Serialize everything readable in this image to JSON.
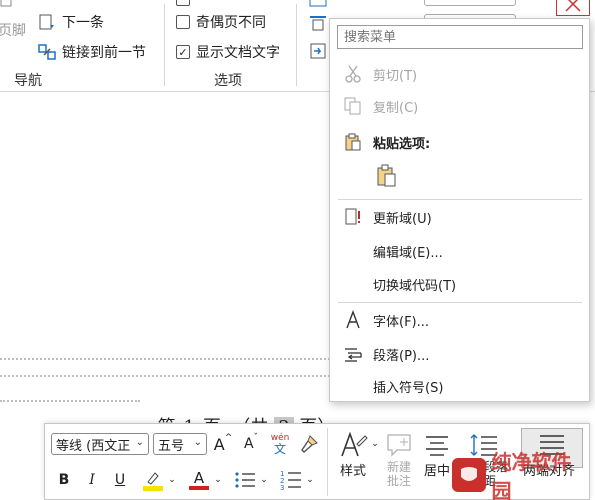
{
  "ribbon": {
    "header_footer_partial": "页脚",
    "next_item": "下一条",
    "link_to_previous": "链接到前一节",
    "nav_group": "导航",
    "odd_even_label": "奇偶页不同",
    "odd_even_checked": false,
    "show_doc_text_label": "显示文档文字",
    "show_doc_text_checked": true,
    "options_group": "选项",
    "checkmark": "✓"
  },
  "document": {
    "footer_parts": [
      "第",
      "1",
      "页",
      "（共",
      "3",
      "页）"
    ]
  },
  "menu": {
    "search_placeholder": "搜索菜单",
    "items": [
      {
        "label": "剪切(T)",
        "icon": "scissors-icon",
        "disabled": true
      },
      {
        "label": "复制(C)",
        "icon": "copy-icon",
        "disabled": true
      },
      {
        "label": "粘贴选项:",
        "icon": "paste-icon",
        "bold": true
      },
      {
        "label": "更新域(U)",
        "icon": "update-field-icon"
      },
      {
        "label": "编辑域(E)...",
        "icon": ""
      },
      {
        "label": "切换域代码(T)",
        "icon": ""
      },
      {
        "label": "字体(F)...",
        "icon": "font-icon"
      },
      {
        "label": "段落(P)...",
        "icon": "paragraph-icon"
      },
      {
        "label": "插入符号(S)",
        "icon": ""
      }
    ]
  },
  "mini_toolbar": {
    "font_name": "等线 (西文正",
    "font_size": "五号",
    "grow_font": "A",
    "shrink_font": "A",
    "phonetic_top": "wén",
    "phonetic_bottom": "文",
    "bold": "B",
    "italic": "I",
    "underline": "U",
    "font_color_letter": "A",
    "styles_label": "样式",
    "new_comment_label_1": "新建",
    "new_comment_label_2": "批注",
    "center_label": "居中",
    "line_spacing_label_1": "行和段落",
    "line_spacing_label_2": "间距",
    "justify_label": "两端对齐",
    "highlight_color": "#f5e400",
    "font_color": "#d32020"
  },
  "watermark": {
    "text": "纯净软件园"
  }
}
